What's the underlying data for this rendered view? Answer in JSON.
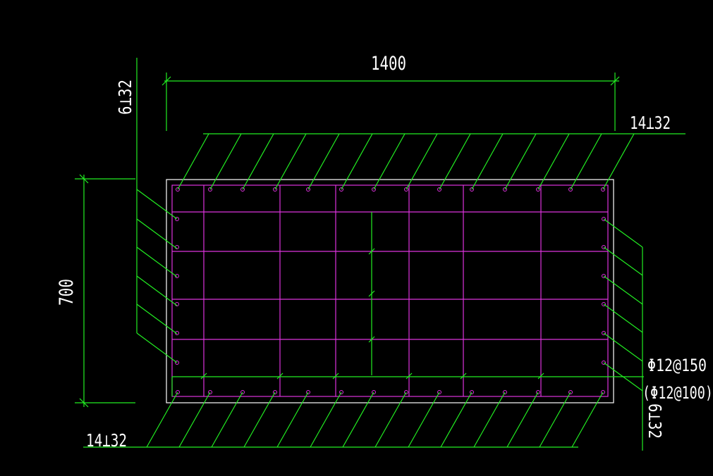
{
  "colors": {
    "background": "#000000",
    "leader": "#22ee22",
    "stirrup": "#dd33dd",
    "outline": "#ffffff",
    "text": "#ffffff"
  },
  "dimensions": {
    "width_label": "1400",
    "height_label": "700"
  },
  "rebar_labels": {
    "top": "14⊥32",
    "bottom": "14⊥32",
    "left_side": "6⊥32",
    "right_side": "6⊥32",
    "stirrup": "Φ12@150",
    "stirrup_dense": "(Φ12@100)"
  }
}
